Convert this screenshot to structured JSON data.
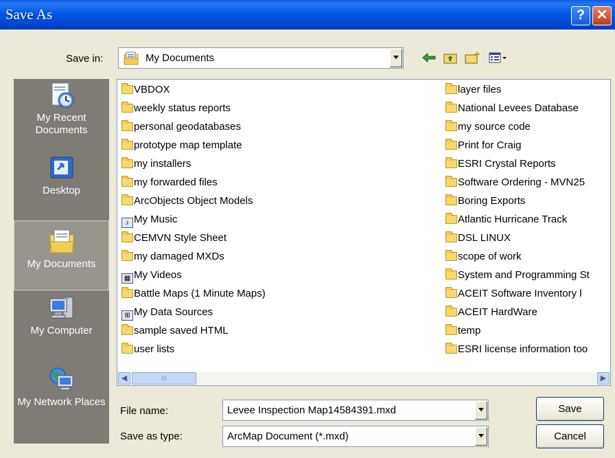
{
  "window": {
    "title": "Save As",
    "help_glyph": "?",
    "close_glyph": "✕"
  },
  "save_in": {
    "label": "Save in:",
    "value": "My Documents"
  },
  "places": [
    {
      "label": "My Recent Documents",
      "icon": "recent-documents-icon"
    },
    {
      "label": "Desktop",
      "icon": "desktop-icon"
    },
    {
      "label": "My Documents",
      "icon": "my-documents-icon"
    },
    {
      "label": "My Computer",
      "icon": "my-computer-icon"
    },
    {
      "label": "My Network Places",
      "icon": "network-places-icon"
    }
  ],
  "files": {
    "col1": [
      {
        "name": "VBDOX",
        "type": "folder"
      },
      {
        "name": "weekly status reports",
        "type": "folder"
      },
      {
        "name": "personal geodatabases",
        "type": "folder"
      },
      {
        "name": "prototype map template",
        "type": "folder"
      },
      {
        "name": "my installers",
        "type": "folder"
      },
      {
        "name": "my forwarded files",
        "type": "folder"
      },
      {
        "name": "ArcObjects Object Models",
        "type": "folder"
      },
      {
        "name": "My Music",
        "type": "music"
      },
      {
        "name": "CEMVN Style Sheet",
        "type": "folder"
      },
      {
        "name": "my damaged MXDs",
        "type": "folder"
      },
      {
        "name": "My Videos",
        "type": "video"
      },
      {
        "name": "Battle Maps (1 Minute Maps)",
        "type": "folder"
      },
      {
        "name": "My Data Sources",
        "type": "datasource"
      },
      {
        "name": "sample saved HTML",
        "type": "folder"
      },
      {
        "name": "user lists",
        "type": "folder"
      }
    ],
    "col2": [
      {
        "name": "layer files",
        "type": "folder"
      },
      {
        "name": "National Levees Database",
        "type": "folder"
      },
      {
        "name": "my source code",
        "type": "folder"
      },
      {
        "name": "Print for Craig",
        "type": "folder"
      },
      {
        "name": "ESRI Crystal Reports",
        "type": "folder"
      },
      {
        "name": "Software Ordering - MVN25",
        "type": "folder"
      },
      {
        "name": "Boring Exports",
        "type": "folder"
      },
      {
        "name": "Atlantic Hurricane Track",
        "type": "folder"
      },
      {
        "name": "DSL LINUX",
        "type": "folder"
      },
      {
        "name": "scope of work",
        "type": "folder"
      },
      {
        "name": "System and Programming St",
        "type": "folder"
      },
      {
        "name": "ACEIT Software Inventory l",
        "type": "folder"
      },
      {
        "name": "ACEIT HardWare",
        "type": "folder"
      },
      {
        "name": "temp",
        "type": "folder"
      },
      {
        "name": "ESRI license information too",
        "type": "folder"
      }
    ]
  },
  "file_name": {
    "label": "File name:",
    "value": "Levee Inspection Map14584391.mxd"
  },
  "save_type": {
    "label": "Save as type:",
    "value": "ArcMap Document (*.mxd)"
  },
  "buttons": {
    "save": "Save",
    "cancel": "Cancel"
  },
  "scroll": {
    "grip": "III",
    "left": "◀",
    "right": "▶"
  }
}
